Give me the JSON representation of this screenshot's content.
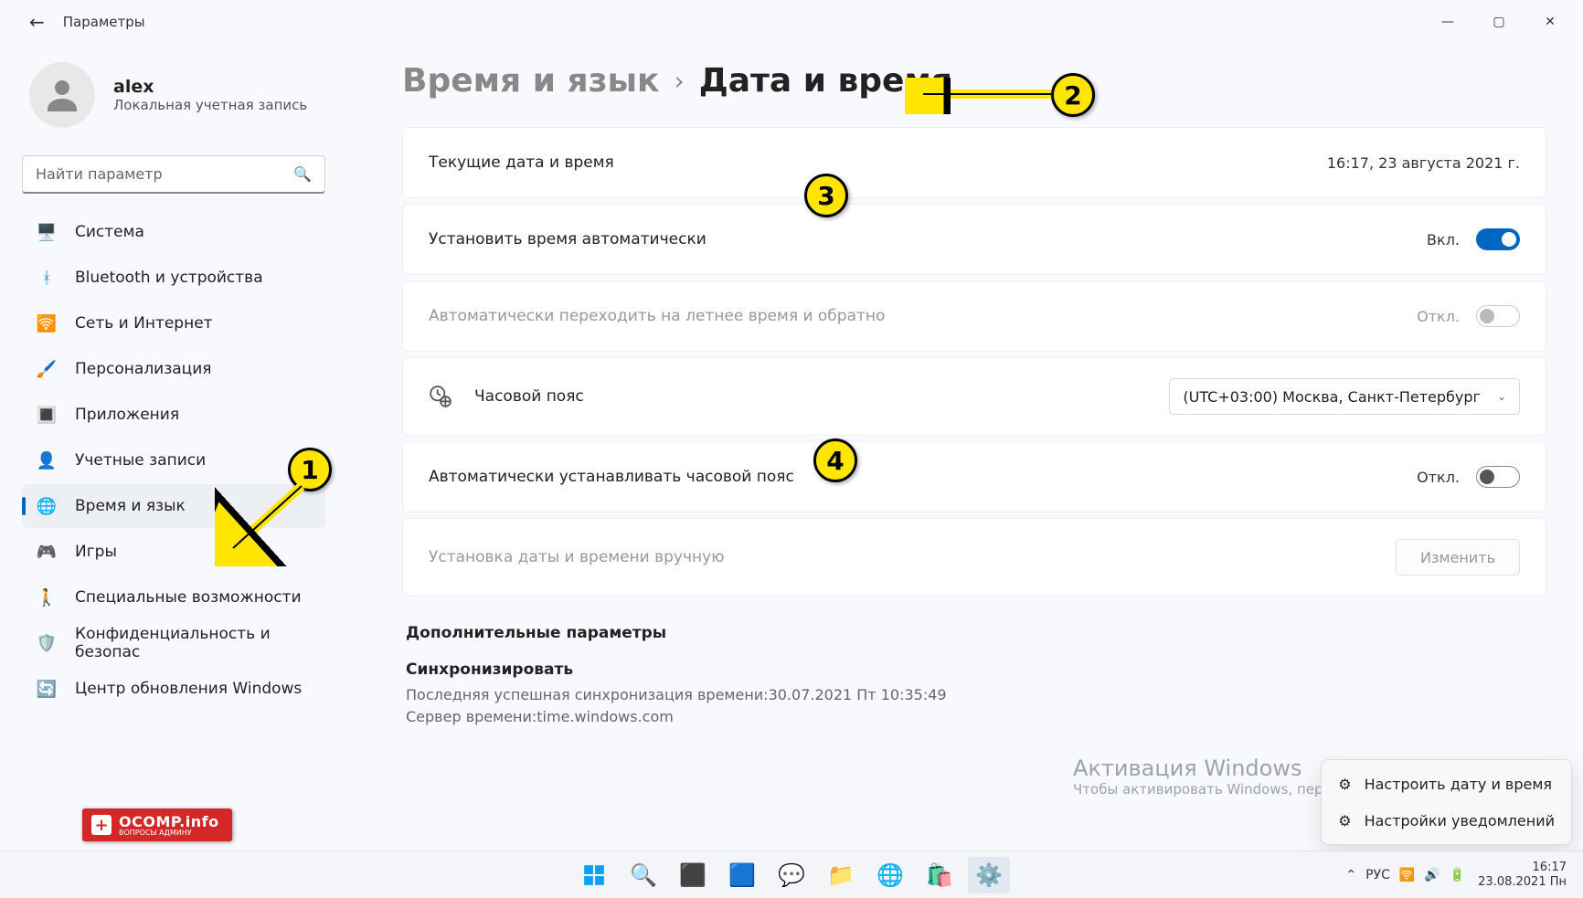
{
  "titlebar": {
    "app_title": "Параметры"
  },
  "profile": {
    "name": "alex",
    "subtitle": "Локальная учетная запись"
  },
  "search": {
    "placeholder": "Найти параметр"
  },
  "nav": {
    "items": [
      {
        "label": "Система"
      },
      {
        "label": "Bluetooth и устройства"
      },
      {
        "label": "Сеть и Интернет"
      },
      {
        "label": "Персонализация"
      },
      {
        "label": "Приложения"
      },
      {
        "label": "Учетные записи"
      },
      {
        "label": "Время и язык"
      },
      {
        "label": "Игры"
      },
      {
        "label": "Специальные возможности"
      },
      {
        "label": "Конфиденциальность и безопас"
      },
      {
        "label": "Центр обновления Windows"
      }
    ]
  },
  "breadcrumb": {
    "parent": "Время и язык",
    "current": "Дата и время"
  },
  "cards": {
    "current": {
      "title": "Текущие дата и время",
      "value": "16:17, 23 августа 2021 г."
    },
    "autoTime": {
      "title": "Установить время автоматически",
      "state": "Вкл."
    },
    "dst": {
      "title": "Автоматически переходить на летнее время и обратно",
      "state": "Откл."
    },
    "tz": {
      "title": "Часовой пояс",
      "value": "(UTC+03:00) Москва, Санкт-Петербург"
    },
    "autoTz": {
      "title": "Автоматически устанавливать часовой пояс",
      "state": "Откл."
    },
    "manual": {
      "title": "Установка даты и времени вручную",
      "button": "Изменить"
    }
  },
  "sectionTitle": "Дополнительные параметры",
  "sync": {
    "title": "Синхронизировать",
    "line1": "Последняя успешная синхронизация времени:30.07.2021 Пт 10:35:49",
    "line2": "Сервер времени:time.windows.com"
  },
  "watermark": {
    "title": "Активация Windows",
    "sub": "Чтобы активировать Windows, перейдите в раздел \"Параметры\"."
  },
  "context": {
    "item1": "Настроить дату и время",
    "item2": "Настройки уведомлений"
  },
  "taskbar": {
    "lang": "РУС",
    "time": "16:17",
    "date": "23.08.2021 Пн"
  },
  "annotations": {
    "a1": "1",
    "a2": "2",
    "a3": "3",
    "a4": "4"
  },
  "logo": {
    "text": "OCOMP.info",
    "sub": "ВОПРОСЫ АДМИНУ"
  }
}
